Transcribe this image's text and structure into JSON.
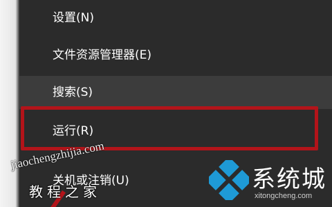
{
  "menu": {
    "items": [
      {
        "label": "设置(N)"
      },
      {
        "label": "文件资源管理器(E)"
      },
      {
        "label": "搜索(S)"
      },
      {
        "label": "运行(R)"
      },
      {
        "label": "关机或注销(U)"
      }
    ],
    "hovered_index": 2,
    "highlighted_index": 3
  },
  "watermarks": {
    "left_url": "jiaochengzhijia.com",
    "left_text": "教程之家",
    "right_text": "系统城",
    "right_url": "xitongcheng.com"
  },
  "colors": {
    "menu_background": "#2b2b2b",
    "hover_background": "#3c3c3c",
    "text": "#ffffff",
    "highlight_border": "#b3141a",
    "logo_blue": "#1e9ad6"
  },
  "icons": {
    "logo": "windows-logo-icon"
  }
}
